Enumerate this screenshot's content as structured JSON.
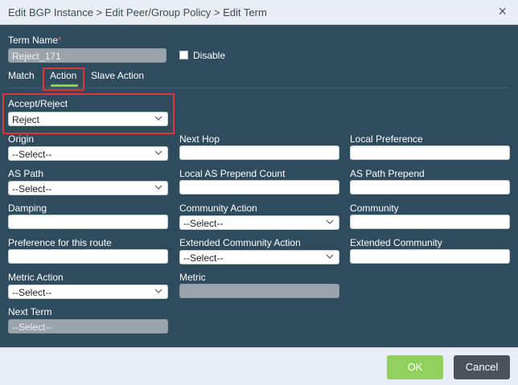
{
  "dialog": {
    "title": "Edit BGP Instance > Edit Peer/Group Policy > Edit Term",
    "close_glyph": "×"
  },
  "term": {
    "name_label": "Term Name",
    "required_mark": "*",
    "name_value": "Reject_171",
    "disable_label": "Disable",
    "disable_checked": false
  },
  "tabs": [
    {
      "label": "Match",
      "active": false
    },
    {
      "label": "Action",
      "active": true
    },
    {
      "label": "Slave Action",
      "active": false
    }
  ],
  "fields": {
    "accept_reject": {
      "label": "Accept/Reject",
      "value": "Reject"
    },
    "origin": {
      "label": "Origin",
      "value": "--Select--"
    },
    "next_hop": {
      "label": "Next Hop",
      "value": ""
    },
    "local_preference": {
      "label": "Local Preference",
      "value": ""
    },
    "as_path": {
      "label": "AS Path",
      "value": "--Select--"
    },
    "local_as_prepend_count": {
      "label": "Local AS Prepend Count",
      "value": ""
    },
    "as_path_prepend": {
      "label": "AS Path Prepend",
      "value": ""
    },
    "damping": {
      "label": "Damping",
      "value": ""
    },
    "community_action": {
      "label": "Community Action",
      "value": "--Select--"
    },
    "community": {
      "label": "Community",
      "value": ""
    },
    "preference": {
      "label": "Preference for this route",
      "value": ""
    },
    "ext_community_action": {
      "label": "Extended Community Action",
      "value": "--Select--"
    },
    "ext_community": {
      "label": "Extended Community",
      "value": ""
    },
    "metric_action": {
      "label": "Metric Action",
      "value": "--Select--"
    },
    "metric": {
      "label": "Metric",
      "value": ""
    },
    "next_term": {
      "label": "Next Term",
      "value": "--Select--"
    }
  },
  "footer": {
    "ok_label": "OK",
    "cancel_label": "Cancel"
  },
  "colors": {
    "panel": "#2f4b5e",
    "accent_green": "#8fd15a",
    "highlight_red": "#e0343a"
  }
}
